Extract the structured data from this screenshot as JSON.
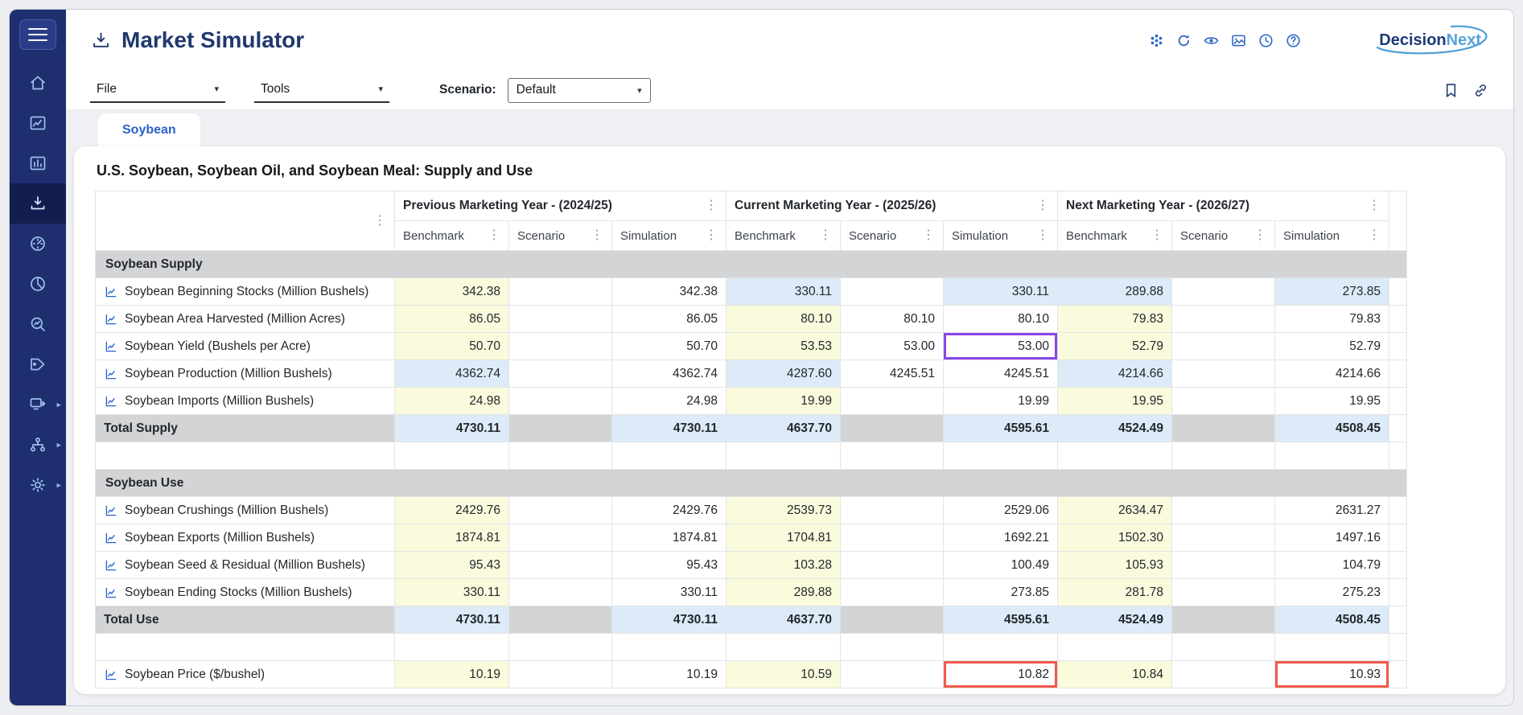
{
  "app": {
    "title": "Market Simulator",
    "brand": {
      "primary": "Decision",
      "secondary": "Next"
    }
  },
  "sidebar": {
    "items": [
      {
        "name": "home",
        "icon": "home"
      },
      {
        "name": "analytics",
        "icon": "line-chart"
      },
      {
        "name": "reports",
        "icon": "bar-chart"
      },
      {
        "name": "market-simulator",
        "icon": "download",
        "active": true
      },
      {
        "name": "gauge",
        "icon": "gauge"
      },
      {
        "name": "pie-chart",
        "icon": "pie-chart"
      },
      {
        "name": "search",
        "icon": "search-chart"
      },
      {
        "name": "tags",
        "icon": "tag"
      },
      {
        "name": "export",
        "icon": "export",
        "caret": true
      },
      {
        "name": "hierarchy",
        "icon": "hierarchy",
        "caret": true
      },
      {
        "name": "settings",
        "icon": "gear",
        "caret": true
      }
    ]
  },
  "header": {
    "icons": [
      {
        "name": "apps"
      },
      {
        "name": "refresh"
      },
      {
        "name": "eye"
      },
      {
        "name": "image"
      },
      {
        "name": "clock"
      },
      {
        "name": "help"
      }
    ]
  },
  "menubar": {
    "file_label": "File",
    "tools_label": "Tools",
    "scenario_label": "Scenario:",
    "scenario_value": "Default"
  },
  "tabs": [
    {
      "label": "Soybean",
      "active": true
    }
  ],
  "content": {
    "title": "U.S. Soybean, Soybean Oil, and Soybean Meal: Supply and Use"
  },
  "colors": {
    "sidebar_bg": "#1e2e6e",
    "accent_blue": "#2b62c9",
    "benchmark_cell": "#fafadd",
    "computed_cell": "#dcebf7",
    "section_row": "#d3d4d6",
    "highlight_purple": "#8a46e8",
    "highlight_red": "#f2594b",
    "brand_dark": "#1d3a77",
    "brand_light": "#58a2da"
  },
  "table": {
    "year_groups": [
      "Previous Marketing Year - (2024/25)",
      "Current Marketing Year - (2025/26)",
      "Next Marketing Year - (2026/27)"
    ],
    "sub_columns": [
      "Benchmark",
      "Scenario",
      "Simulation"
    ],
    "rows": [
      {
        "type": "section",
        "label": "Soybean Supply"
      },
      {
        "type": "data",
        "label": "Soybean Beginning Stocks (Million Bushels)",
        "values": [
          "342.38",
          "",
          "342.38",
          "330.11",
          "",
          "330.11",
          "289.88",
          "",
          "273.85"
        ],
        "bgs": [
          "y",
          "w",
          "w",
          "b",
          "w",
          "b",
          "b",
          "w",
          "b"
        ]
      },
      {
        "type": "data",
        "label": "Soybean Area Harvested (Million Acres)",
        "values": [
          "86.05",
          "",
          "86.05",
          "80.10",
          "80.10",
          "80.10",
          "79.83",
          "",
          "79.83"
        ],
        "bgs": [
          "y",
          "w",
          "w",
          "y",
          "w",
          "w",
          "y",
          "w",
          "w"
        ]
      },
      {
        "type": "data",
        "label": "Soybean Yield (Bushels per Acre)",
        "values": [
          "50.70",
          "",
          "50.70",
          "53.53",
          "53.00",
          "53.00",
          "52.79",
          "",
          "52.79"
        ],
        "bgs": [
          "y",
          "w",
          "w",
          "y",
          "w",
          "w",
          "y",
          "w",
          "w"
        ],
        "outlines": {
          "5": "purple"
        }
      },
      {
        "type": "data",
        "label": "Soybean Production (Million Bushels)",
        "values": [
          "4362.74",
          "",
          "4362.74",
          "4287.60",
          "4245.51",
          "4245.51",
          "4214.66",
          "",
          "4214.66"
        ],
        "bgs": [
          "b",
          "w",
          "w",
          "b",
          "w",
          "w",
          "b",
          "w",
          "w"
        ]
      },
      {
        "type": "data",
        "label": "Soybean Imports (Million Bushels)",
        "values": [
          "24.98",
          "",
          "24.98",
          "19.99",
          "",
          "19.99",
          "19.95",
          "",
          "19.95"
        ],
        "bgs": [
          "y",
          "w",
          "w",
          "y",
          "w",
          "w",
          "y",
          "w",
          "w"
        ]
      },
      {
        "type": "total",
        "label": "Total Supply",
        "values": [
          "4730.11",
          "",
          "4730.11",
          "4637.70",
          "",
          "4595.61",
          "4524.49",
          "",
          "4508.45"
        ],
        "bgs": [
          "b",
          "g",
          "b",
          "b",
          "g",
          "b",
          "b",
          "g",
          "b"
        ]
      },
      {
        "type": "spacer"
      },
      {
        "type": "section",
        "label": "Soybean Use"
      },
      {
        "type": "data",
        "label": "Soybean Crushings (Million Bushels)",
        "values": [
          "2429.76",
          "",
          "2429.76",
          "2539.73",
          "",
          "2529.06",
          "2634.47",
          "",
          "2631.27"
        ],
        "bgs": [
          "y",
          "w",
          "w",
          "y",
          "w",
          "w",
          "y",
          "w",
          "w"
        ]
      },
      {
        "type": "data",
        "label": "Soybean Exports (Million Bushels)",
        "values": [
          "1874.81",
          "",
          "1874.81",
          "1704.81",
          "",
          "1692.21",
          "1502.30",
          "",
          "1497.16"
        ],
        "bgs": [
          "y",
          "w",
          "w",
          "y",
          "w",
          "w",
          "y",
          "w",
          "w"
        ]
      },
      {
        "type": "data",
        "label": "Soybean Seed & Residual (Million Bushels)",
        "values": [
          "95.43",
          "",
          "95.43",
          "103.28",
          "",
          "100.49",
          "105.93",
          "",
          "104.79"
        ],
        "bgs": [
          "y",
          "w",
          "w",
          "y",
          "w",
          "w",
          "y",
          "w",
          "w"
        ]
      },
      {
        "type": "data",
        "label": "Soybean Ending Stocks (Million Bushels)",
        "values": [
          "330.11",
          "",
          "330.11",
          "289.88",
          "",
          "273.85",
          "281.78",
          "",
          "275.23"
        ],
        "bgs": [
          "y",
          "w",
          "w",
          "y",
          "w",
          "w",
          "y",
          "w",
          "w"
        ]
      },
      {
        "type": "total",
        "label": "Total Use",
        "values": [
          "4730.11",
          "",
          "4730.11",
          "4637.70",
          "",
          "4595.61",
          "4524.49",
          "",
          "4508.45"
        ],
        "bgs": [
          "b",
          "g",
          "b",
          "b",
          "g",
          "b",
          "b",
          "g",
          "b"
        ]
      },
      {
        "type": "spacer"
      },
      {
        "type": "data",
        "label": "Soybean Price ($/bushel)",
        "values": [
          "10.19",
          "",
          "10.19",
          "10.59",
          "",
          "10.82",
          "10.84",
          "",
          "10.93"
        ],
        "bgs": [
          "y",
          "w",
          "w",
          "y",
          "w",
          "w",
          "y",
          "w",
          "w"
        ],
        "outlines": {
          "5": "red",
          "8": "red"
        }
      }
    ]
  }
}
